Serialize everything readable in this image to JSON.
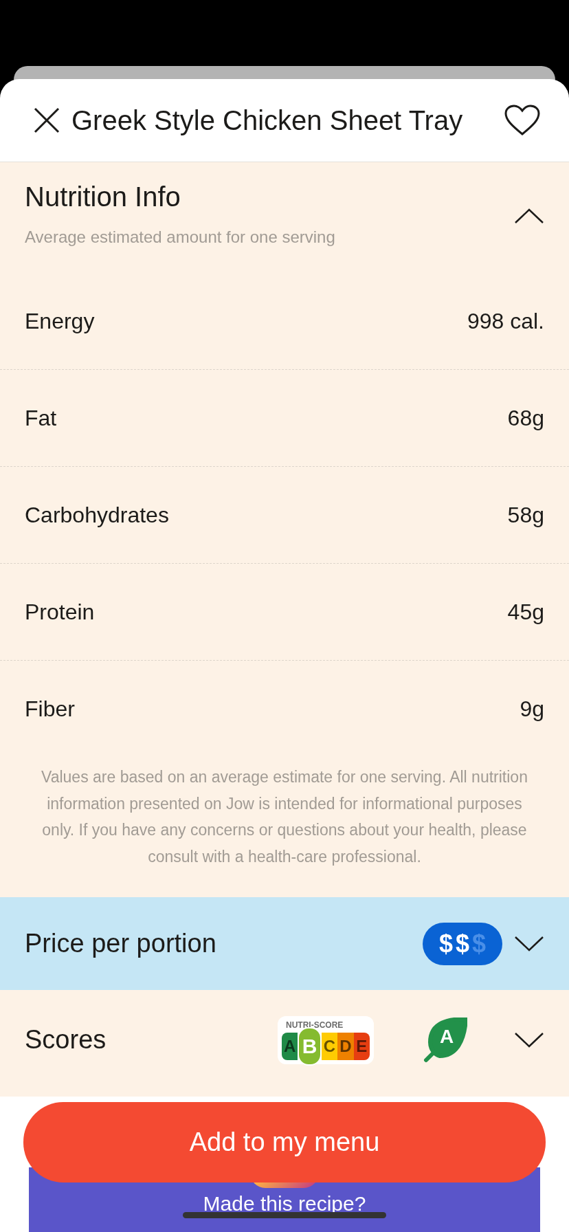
{
  "header": {
    "title": "Greek Style Chicken Sheet Tray",
    "liked": false
  },
  "nutrition": {
    "title": "Nutrition Info",
    "subtitle": "Average estimated amount for one serving",
    "expanded": true,
    "rows": [
      {
        "label": "Energy",
        "value": "998 cal."
      },
      {
        "label": "Fat",
        "value": "68g"
      },
      {
        "label": "Carbohydrates",
        "value": "58g"
      },
      {
        "label": "Protein",
        "value": "45g"
      },
      {
        "label": "Fiber",
        "value": "9g"
      }
    ],
    "disclaimer": "Values are based on an average estimate for one serving. All nutrition information presented on Jow is intended for informational purposes only. If you have any concerns or questions about your health, please consult with a health-care professional."
  },
  "price": {
    "title": "Price per portion",
    "expanded": false,
    "symbols": [
      {
        "text": "$",
        "on": true
      },
      {
        "text": "$",
        "on": true
      },
      {
        "text": "$",
        "on": false
      }
    ]
  },
  "scores": {
    "title": "Scores",
    "expanded": false,
    "nutri_score": {
      "label": "NUTRI-SCORE",
      "grades": [
        {
          "letter": "A",
          "selected": false,
          "color": "#1f8a47"
        },
        {
          "letter": "B",
          "selected": true,
          "color": "#85bb2f"
        },
        {
          "letter": "C",
          "selected": false,
          "color": "#fecb02"
        },
        {
          "letter": "D",
          "selected": false,
          "color": "#ee8100"
        },
        {
          "letter": "E",
          "selected": false,
          "color": "#e63e11"
        }
      ]
    },
    "eco_score": {
      "letter": "A"
    }
  },
  "add_button": {
    "label": "Add to my menu"
  },
  "share_card": {
    "text": "Made this recipe?"
  }
}
